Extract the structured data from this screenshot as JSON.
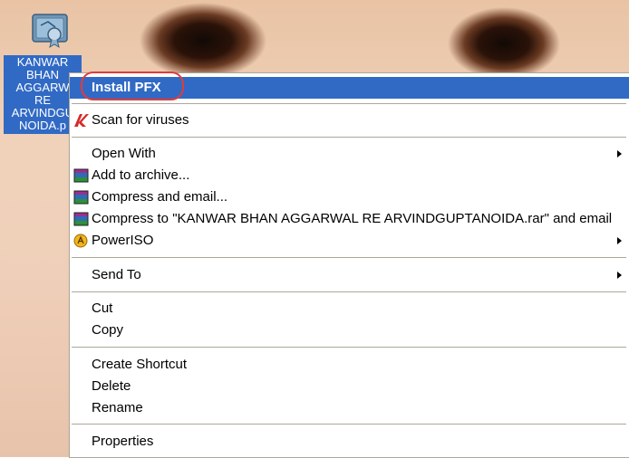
{
  "desktop": {
    "file_icon": "pfx-certificate-file-icon",
    "caption_lines": [
      "KANWAR",
      "BHAN",
      "AGGARW",
      "RE",
      "ARVINDGU",
      "NOIDA.p"
    ]
  },
  "menu": {
    "install": "Install PFX",
    "scan": "Scan for viruses",
    "open_with": "Open With",
    "add_archive": "Add to archive...",
    "compress_email": "Compress and email...",
    "compress_to": "Compress to \"KANWAR BHAN AGGARWAL RE ARVINDGUPTANOIDA.rar\" and email",
    "poweriso": "PowerISO",
    "send_to": "Send To",
    "cut": "Cut",
    "copy": "Copy",
    "create_shortcut": "Create Shortcut",
    "delete": "Delete",
    "rename": "Rename",
    "properties": "Properties"
  },
  "colors": {
    "selection": "#316ac5",
    "menu_border": "#aca899",
    "annotation": "#e23b3b"
  }
}
